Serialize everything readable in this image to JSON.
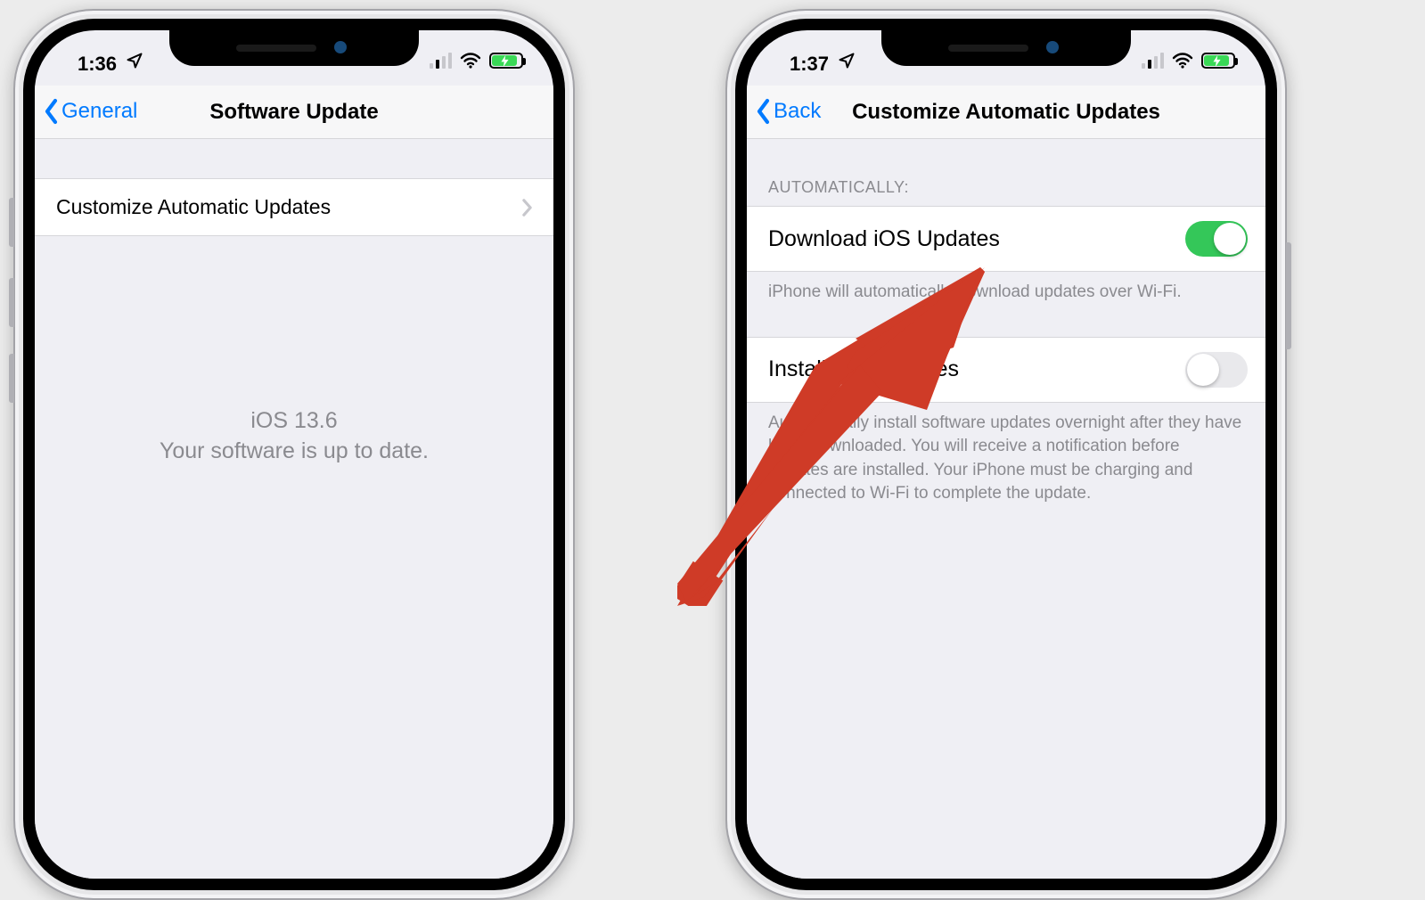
{
  "left": {
    "status": {
      "time": "1:36"
    },
    "nav": {
      "back": "General",
      "title": "Software Update"
    },
    "row": {
      "label": "Customize Automatic Updates"
    },
    "msg": {
      "version": "iOS 13.6",
      "uptodate": "Your software is up to date."
    }
  },
  "right": {
    "status": {
      "time": "1:37"
    },
    "nav": {
      "back": "Back",
      "title": "Customize Automatic Updates"
    },
    "section_header": "AUTOMATICALLY:",
    "download": {
      "label": "Download iOS Updates",
      "footer": "iPhone will automatically download updates over Wi-Fi."
    },
    "install": {
      "label": "Install iOS Updates",
      "footer": "Automatically install software updates overnight after they have been downloaded. You will receive a notification before updates are installed. Your iPhone must be charging and connected to Wi-Fi to complete the update."
    }
  }
}
